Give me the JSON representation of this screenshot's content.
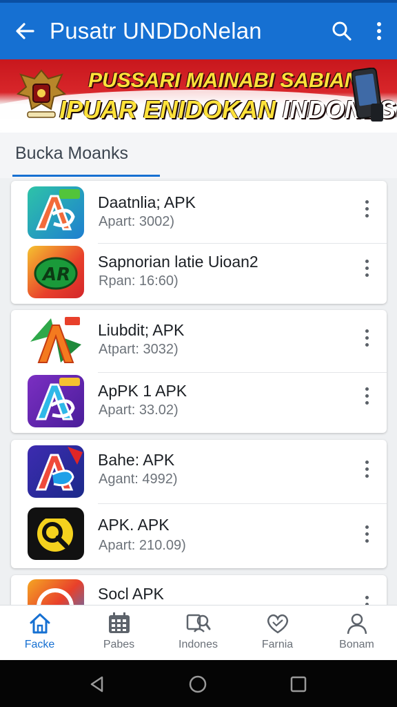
{
  "appbar": {
    "title": "Pusatr UNDDoNelan"
  },
  "banner": {
    "line1": "PUSSARI MAINABI SABIANI",
    "line2_part1": "IPUAR ENIDOKAN",
    "line2_part2": "INDONESIA"
  },
  "section": {
    "tab_label": "Bucka Moanks"
  },
  "apps": [
    {
      "name": "Daatnlia; APK",
      "meta": "Apart: 3002)"
    },
    {
      "name": "Sapnorian latie Uioan2",
      "meta": "Rpan: 16:60)"
    },
    {
      "name": "Liubdit; APK",
      "meta": "Atpart: 3032)"
    },
    {
      "name": "ApPK 1 APK",
      "meta": "Apart: 33.02)"
    },
    {
      "name": "Bahe: APK",
      "meta": "Agant: 4992)"
    },
    {
      "name": "APK. APK",
      "meta": "Apart: 210.09)"
    },
    {
      "name": "Socl APK",
      "meta": ""
    }
  ],
  "bottom_nav": [
    {
      "label": "Facke",
      "icon": "home-icon"
    },
    {
      "label": "Pabes",
      "icon": "grid-icon"
    },
    {
      "label": "Indones",
      "icon": "people-search-icon"
    },
    {
      "label": "Farnia",
      "icon": "heart-icon"
    },
    {
      "label": "Bonam",
      "icon": "person-icon"
    }
  ],
  "colors": {
    "primary": "#1670d2",
    "banner_red": "#c8171d",
    "banner_text": "#ffe23a"
  }
}
